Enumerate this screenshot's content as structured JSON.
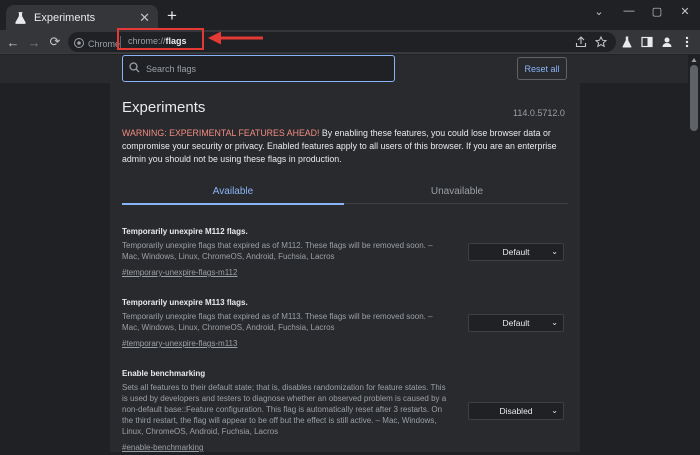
{
  "tab": {
    "title": "Experiments",
    "close": "✕"
  },
  "newtab": "+",
  "window": {
    "chevron": "⌄",
    "minimize": "—",
    "maximize": "▢",
    "close": "✕"
  },
  "nav": {
    "back": "←",
    "forward": "→",
    "reload": "⟳"
  },
  "omnibox": {
    "site_label": "Chrome",
    "url_prefix": "chrome://",
    "url_bold": "flags"
  },
  "search": {
    "placeholder": "Search flags"
  },
  "reset_label": "Reset all",
  "page": {
    "title": "Experiments",
    "version": "114.0.5712.0",
    "warning_red": "WARNING: EXPERIMENTAL FEATURES AHEAD!",
    "warning_rest": " By enabling these features, you could lose browser data or compromise your security or privacy. Enabled features apply to all users of this browser. If you are an enterprise admin you should not be using these flags in production."
  },
  "tabs": {
    "available": "Available",
    "unavailable": "Unavailable"
  },
  "flags": [
    {
      "name": "Temporarily unexpire M112 flags.",
      "desc": "Temporarily unexpire flags that expired as of M112. These flags will be removed soon. – Mac, Windows, Linux, ChromeOS, Android, Fuchsia, Lacros",
      "link": "#temporary-unexpire-flags-m112",
      "value": "Default"
    },
    {
      "name": "Temporarily unexpire M113 flags.",
      "desc": "Temporarily unexpire flags that expired as of M113. These flags will be removed soon. – Mac, Windows, Linux, ChromeOS, Android, Fuchsia, Lacros",
      "link": "#temporary-unexpire-flags-m113",
      "value": "Default"
    },
    {
      "name": "Enable benchmarking",
      "desc": "Sets all features to their default state; that is, disables randomization for feature states. This is used by developers and testers to diagnose whether an observed problem is caused by a non-default base::Feature configuration. This flag is automatically reset after 3 restarts. On the third restart, the flag will appear to be off but the effect is still active. – Mac, Windows, Linux, ChromeOS, Android, Fuchsia, Lacros",
      "link": "#enable-benchmarking",
      "value": "Disabled"
    }
  ],
  "select_chevron": "⌄",
  "colors": {
    "accent": "#8ab4f8",
    "warning": "#f28b82",
    "highlight": "#e53935"
  }
}
